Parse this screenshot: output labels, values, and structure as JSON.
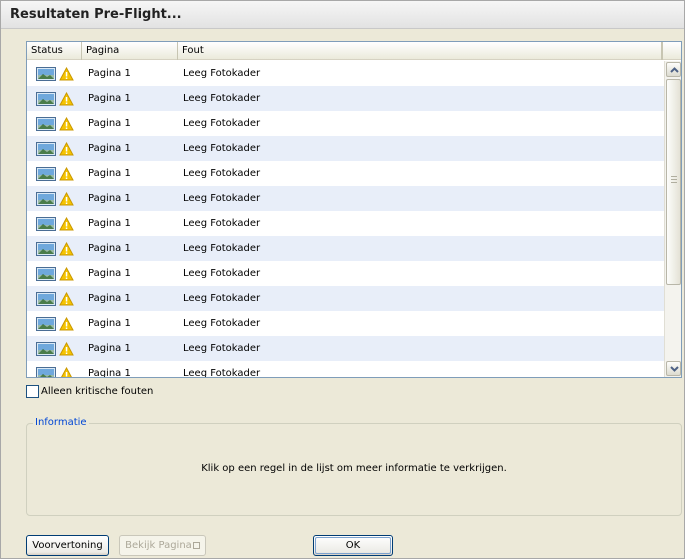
{
  "window": {
    "title": "Resultaten Pre-Flight..."
  },
  "list": {
    "columns": {
      "status": "Status",
      "page": "Pagina",
      "fault": "Fout"
    },
    "rows": [
      {
        "status_icons": [
          "picture-frame-icon",
          "warning-icon"
        ],
        "page": "Pagina 1",
        "fault": "Leeg Fotokader"
      },
      {
        "status_icons": [
          "picture-frame-icon",
          "warning-icon"
        ],
        "page": "Pagina 1",
        "fault": "Leeg Fotokader"
      },
      {
        "status_icons": [
          "picture-frame-icon",
          "warning-icon"
        ],
        "page": "Pagina 1",
        "fault": "Leeg Fotokader"
      },
      {
        "status_icons": [
          "picture-frame-icon",
          "warning-icon"
        ],
        "page": "Pagina 1",
        "fault": "Leeg Fotokader"
      },
      {
        "status_icons": [
          "picture-frame-icon",
          "warning-icon"
        ],
        "page": "Pagina 1",
        "fault": "Leeg Fotokader"
      },
      {
        "status_icons": [
          "picture-frame-icon",
          "warning-icon"
        ],
        "page": "Pagina 1",
        "fault": "Leeg Fotokader"
      },
      {
        "status_icons": [
          "picture-frame-icon",
          "warning-icon"
        ],
        "page": "Pagina 1",
        "fault": "Leeg Fotokader"
      },
      {
        "status_icons": [
          "picture-frame-icon",
          "warning-icon"
        ],
        "page": "Pagina 1",
        "fault": "Leeg Fotokader"
      },
      {
        "status_icons": [
          "picture-frame-icon",
          "warning-icon"
        ],
        "page": "Pagina 1",
        "fault": "Leeg Fotokader"
      },
      {
        "status_icons": [
          "picture-frame-icon",
          "warning-icon"
        ],
        "page": "Pagina 1",
        "fault": "Leeg Fotokader"
      },
      {
        "status_icons": [
          "picture-frame-icon",
          "warning-icon"
        ],
        "page": "Pagina 1",
        "fault": "Leeg Fotokader"
      },
      {
        "status_icons": [
          "picture-frame-icon",
          "warning-icon"
        ],
        "page": "Pagina 1",
        "fault": "Leeg Fotokader"
      },
      {
        "status_icons": [
          "picture-frame-icon",
          "warning-icon"
        ],
        "page": "Pagina 1",
        "fault": "Leeg Fotokader"
      }
    ]
  },
  "filter": {
    "critical_only_label": "Alleen kritische fouten",
    "critical_only_checked": false
  },
  "info": {
    "group_label": "Informatie",
    "text": "Klik op een regel in de lijst om meer informatie te verkrijgen."
  },
  "buttons": {
    "preview": "Voorvertoning",
    "view_page": "Bekijk Pagina",
    "ok": "OK"
  },
  "colors": {
    "row_alt": "#e8eef9",
    "group_label": "#0046d5",
    "warning": "#f5c400"
  }
}
